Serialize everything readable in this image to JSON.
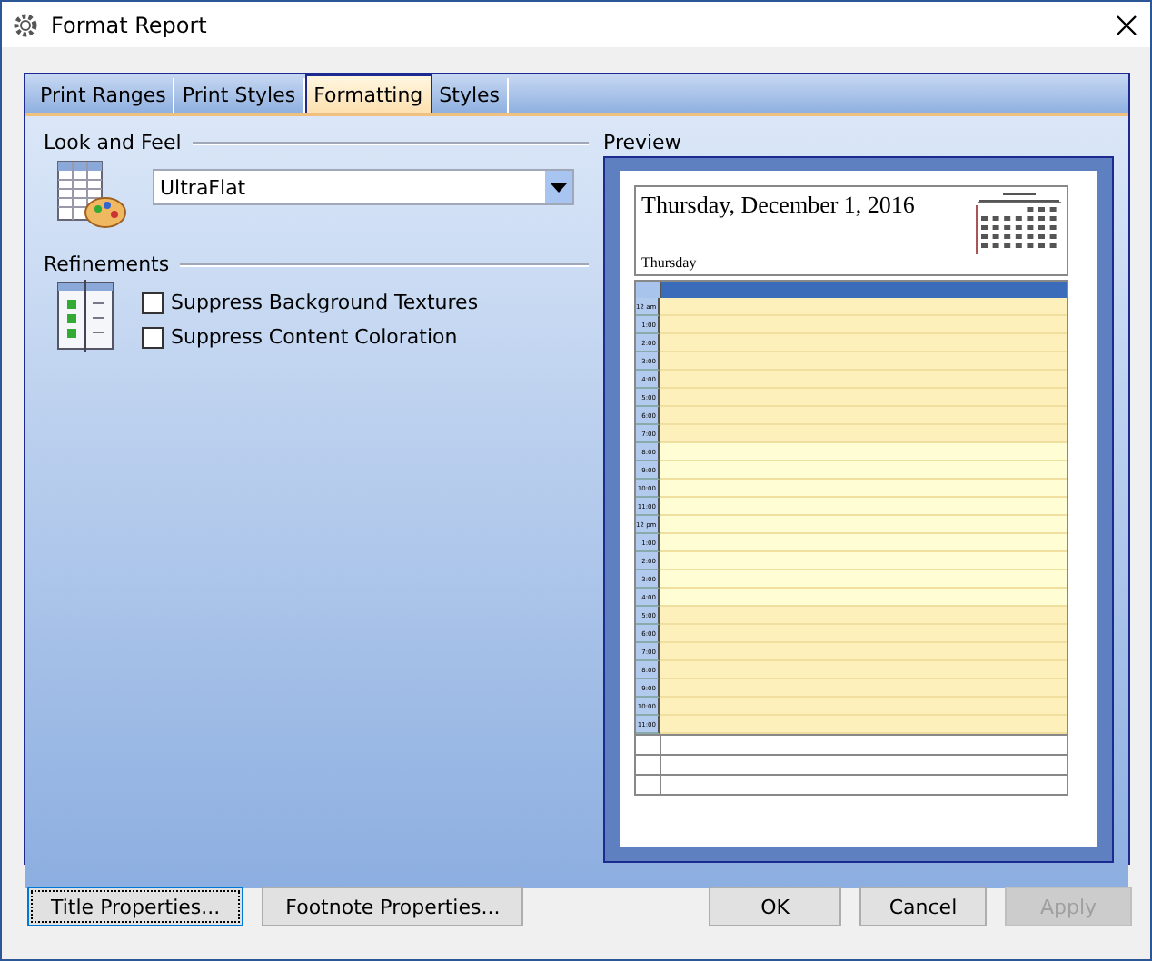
{
  "window": {
    "title": "Format Report"
  },
  "tabs": [
    {
      "label": "Print Ranges",
      "selected": false
    },
    {
      "label": "Print Styles",
      "selected": false
    },
    {
      "label": "Formatting",
      "selected": true
    },
    {
      "label": "Styles",
      "selected": false
    }
  ],
  "look_and_feel": {
    "heading": "Look and Feel",
    "dropdown": {
      "value": "UltraFlat"
    }
  },
  "refinements": {
    "heading": "Refinements",
    "options": [
      {
        "label": "Suppress Background Textures",
        "checked": false
      },
      {
        "label": "Suppress Content Coloration",
        "checked": false
      }
    ]
  },
  "preview": {
    "heading": "Preview",
    "title": "Thursday, December 1, 2016",
    "subtitle": "Thursday",
    "time_slots": [
      {
        "label": "12 am",
        "shaded": true
      },
      {
        "label": "1:00",
        "shaded": true
      },
      {
        "label": "2:00",
        "shaded": true
      },
      {
        "label": "3:00",
        "shaded": true
      },
      {
        "label": "4:00",
        "shaded": true
      },
      {
        "label": "5:00",
        "shaded": true
      },
      {
        "label": "6:00",
        "shaded": true
      },
      {
        "label": "7:00",
        "shaded": true
      },
      {
        "label": "8:00",
        "shaded": false
      },
      {
        "label": "9:00",
        "shaded": false
      },
      {
        "label": "10:00",
        "shaded": false
      },
      {
        "label": "11:00",
        "shaded": false
      },
      {
        "label": "12 pm",
        "shaded": false
      },
      {
        "label": "1:00",
        "shaded": false
      },
      {
        "label": "2:00",
        "shaded": false
      },
      {
        "label": "3:00",
        "shaded": false
      },
      {
        "label": "4:00",
        "shaded": false
      },
      {
        "label": "5:00",
        "shaded": true
      },
      {
        "label": "6:00",
        "shaded": true
      },
      {
        "label": "7:00",
        "shaded": true
      },
      {
        "label": "8:00",
        "shaded": true
      },
      {
        "label": "9:00",
        "shaded": true
      },
      {
        "label": "10:00",
        "shaded": true
      },
      {
        "label": "11:00",
        "shaded": true
      }
    ]
  },
  "buttons": [
    {
      "label": "Title Properties...",
      "kind": "focused",
      "disabled": false
    },
    {
      "label": "Footnote Properties...",
      "kind": "normal",
      "disabled": false
    },
    {
      "label": "OK",
      "kind": "normal",
      "disabled": false
    },
    {
      "label": "Cancel",
      "kind": "normal",
      "disabled": false
    },
    {
      "label": "Apply",
      "kind": "normal",
      "disabled": true
    }
  ]
}
